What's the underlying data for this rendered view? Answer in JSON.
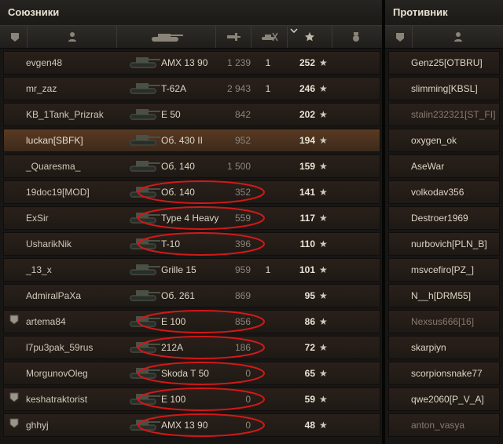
{
  "allies": {
    "title": "Союзники",
    "rows": [
      {
        "nick": "evgen48",
        "tank": "AMX 13 90",
        "xp": "1 239",
        "kills": "1",
        "points": "252",
        "highlight": false,
        "badge": false,
        "circled": false
      },
      {
        "nick": "mr_zaz",
        "tank": "T-62A",
        "xp": "2 943",
        "kills": "1",
        "points": "246",
        "highlight": false,
        "badge": false,
        "circled": false
      },
      {
        "nick": "KB_1Tank_Prizrak",
        "tank": "E 50",
        "xp": "842",
        "kills": "",
        "points": "202",
        "highlight": false,
        "badge": false,
        "circled": false
      },
      {
        "nick": "luckan[SBFK]",
        "tank": "Об. 430 II",
        "xp": "952",
        "kills": "",
        "points": "194",
        "highlight": true,
        "badge": false,
        "circled": false
      },
      {
        "nick": "_Quaresma_",
        "tank": "Об. 140",
        "xp": "1 500",
        "kills": "",
        "points": "159",
        "highlight": false,
        "badge": false,
        "circled": false
      },
      {
        "nick": "19doc19[MOD]",
        "tank": "Об. 140",
        "xp": "352",
        "kills": "",
        "points": "141",
        "highlight": false,
        "badge": false,
        "circled": true
      },
      {
        "nick": "ExSir",
        "tank": "Type 4 Heavy",
        "xp": "559",
        "kills": "",
        "points": "117",
        "highlight": false,
        "badge": false,
        "circled": true
      },
      {
        "nick": "UsharikNik",
        "tank": "T-10",
        "xp": "396",
        "kills": "",
        "points": "110",
        "highlight": false,
        "badge": false,
        "circled": true
      },
      {
        "nick": "_13_x",
        "tank": "Grille 15",
        "xp": "959",
        "kills": "1",
        "points": "101",
        "highlight": false,
        "badge": false,
        "circled": false
      },
      {
        "nick": "AdmiralPaXa",
        "tank": "Об. 261",
        "xp": "869",
        "kills": "",
        "points": "95",
        "highlight": false,
        "badge": false,
        "circled": false
      },
      {
        "nick": "artema84",
        "tank": "E 100",
        "xp": "856",
        "kills": "",
        "points": "86",
        "highlight": false,
        "badge": true,
        "circled": true
      },
      {
        "nick": "l7pu3pak_59rus",
        "tank": "212A",
        "xp": "186",
        "kills": "",
        "points": "72",
        "highlight": false,
        "badge": false,
        "circled": true
      },
      {
        "nick": "MorgunovOleg",
        "tank": "Skoda T 50",
        "xp": "0",
        "kills": "",
        "points": "65",
        "highlight": false,
        "badge": false,
        "circled": true
      },
      {
        "nick": "keshatraktorist",
        "tank": "E 100",
        "xp": "0",
        "kills": "",
        "points": "59",
        "highlight": false,
        "badge": true,
        "circled": true
      },
      {
        "nick": "ghhyj",
        "tank": "AMX 13 90",
        "xp": "0",
        "kills": "",
        "points": "48",
        "highlight": false,
        "badge": true,
        "circled": true
      }
    ],
    "star_glyph": "★",
    "header_icons": [
      "badge-icon",
      "player-icon",
      "tank-icon",
      "xp-icon",
      "kills-icon",
      "sort-arrow-icon",
      "points-star-icon",
      "medal-icon"
    ]
  },
  "enemies": {
    "title": "Противник",
    "rows": [
      {
        "nick": "Genz25[OTBRU]",
        "dead": false
      },
      {
        "nick": "slimming[KBSL]",
        "dead": false
      },
      {
        "nick": "stalin232321[ST_FI]",
        "dead": true
      },
      {
        "nick": "oxygen_ok",
        "dead": false
      },
      {
        "nick": "AseWar",
        "dead": false
      },
      {
        "nick": "volkodav356",
        "dead": false
      },
      {
        "nick": "Destroer1969",
        "dead": false
      },
      {
        "nick": "nurbovich[PLN_B]",
        "dead": false
      },
      {
        "nick": "msvcefiro[PZ_]",
        "dead": false
      },
      {
        "nick": "N__h[DRM55]",
        "dead": false
      },
      {
        "nick": "Nexsus666[16]",
        "dead": true
      },
      {
        "nick": "skarpiyn",
        "dead": false
      },
      {
        "nick": "scorpionsnake77",
        "dead": false
      },
      {
        "nick": "qwe2060[P_V_A]",
        "dead": false
      },
      {
        "nick": "anton_vasya",
        "dead": true
      }
    ]
  },
  "colors": {
    "highlight": "#5a3a22",
    "annotation": "#d11919",
    "text": "#ddd6c6"
  }
}
